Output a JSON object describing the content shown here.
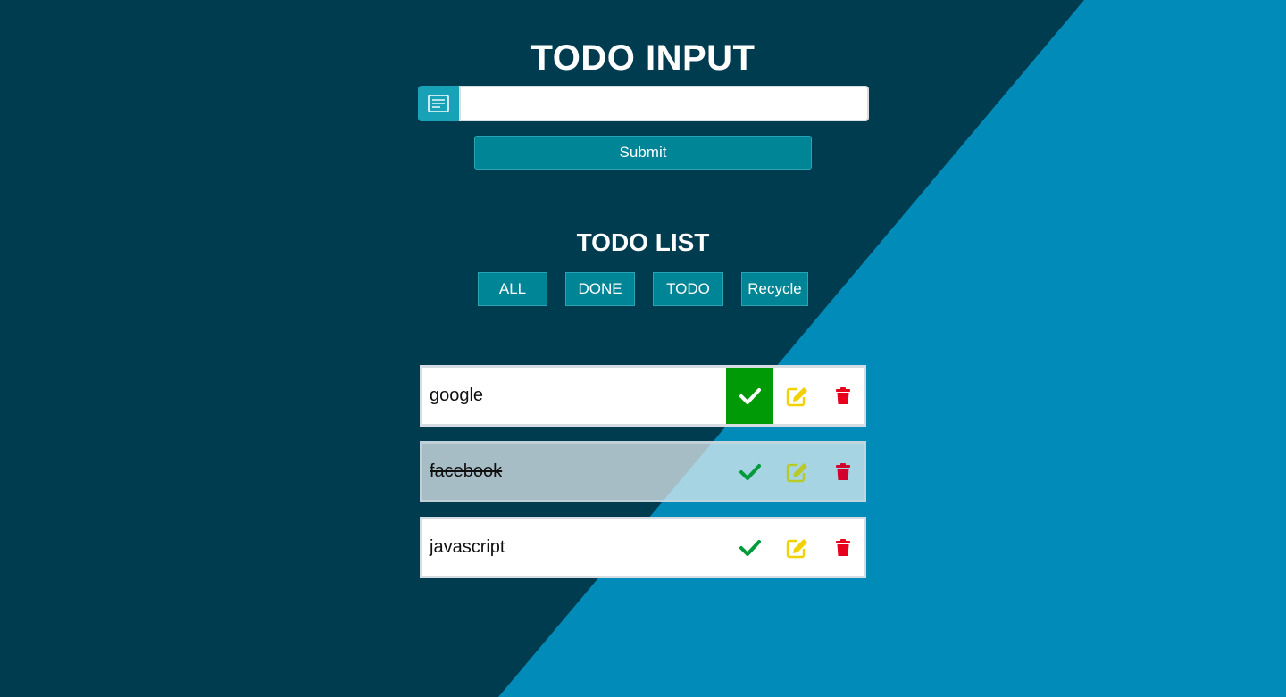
{
  "header": {
    "title": "TODO INPUT"
  },
  "input": {
    "value": "",
    "placeholder": ""
  },
  "submit": {
    "label": "Submit"
  },
  "list": {
    "title": "TODO LIST",
    "filters": [
      "ALL",
      "DONE",
      "TODO",
      "Recycle"
    ],
    "items": [
      {
        "text": "google",
        "done": false,
        "check_highlighted": true
      },
      {
        "text": "facebook",
        "done": true,
        "check_highlighted": false
      },
      {
        "text": "javascript",
        "done": false,
        "check_highlighted": false
      }
    ]
  },
  "colors": {
    "background_dark": "#003c50",
    "background_light": "#008bb8",
    "button": "#008596",
    "input_icon": "#17a2b8",
    "check_green": "#009a06",
    "edit_yellow": "#f2d100",
    "delete_red": "#e8001c"
  },
  "icons": {
    "input": "notes-icon",
    "check": "check-icon",
    "edit": "edit-icon",
    "delete": "trash-icon"
  }
}
